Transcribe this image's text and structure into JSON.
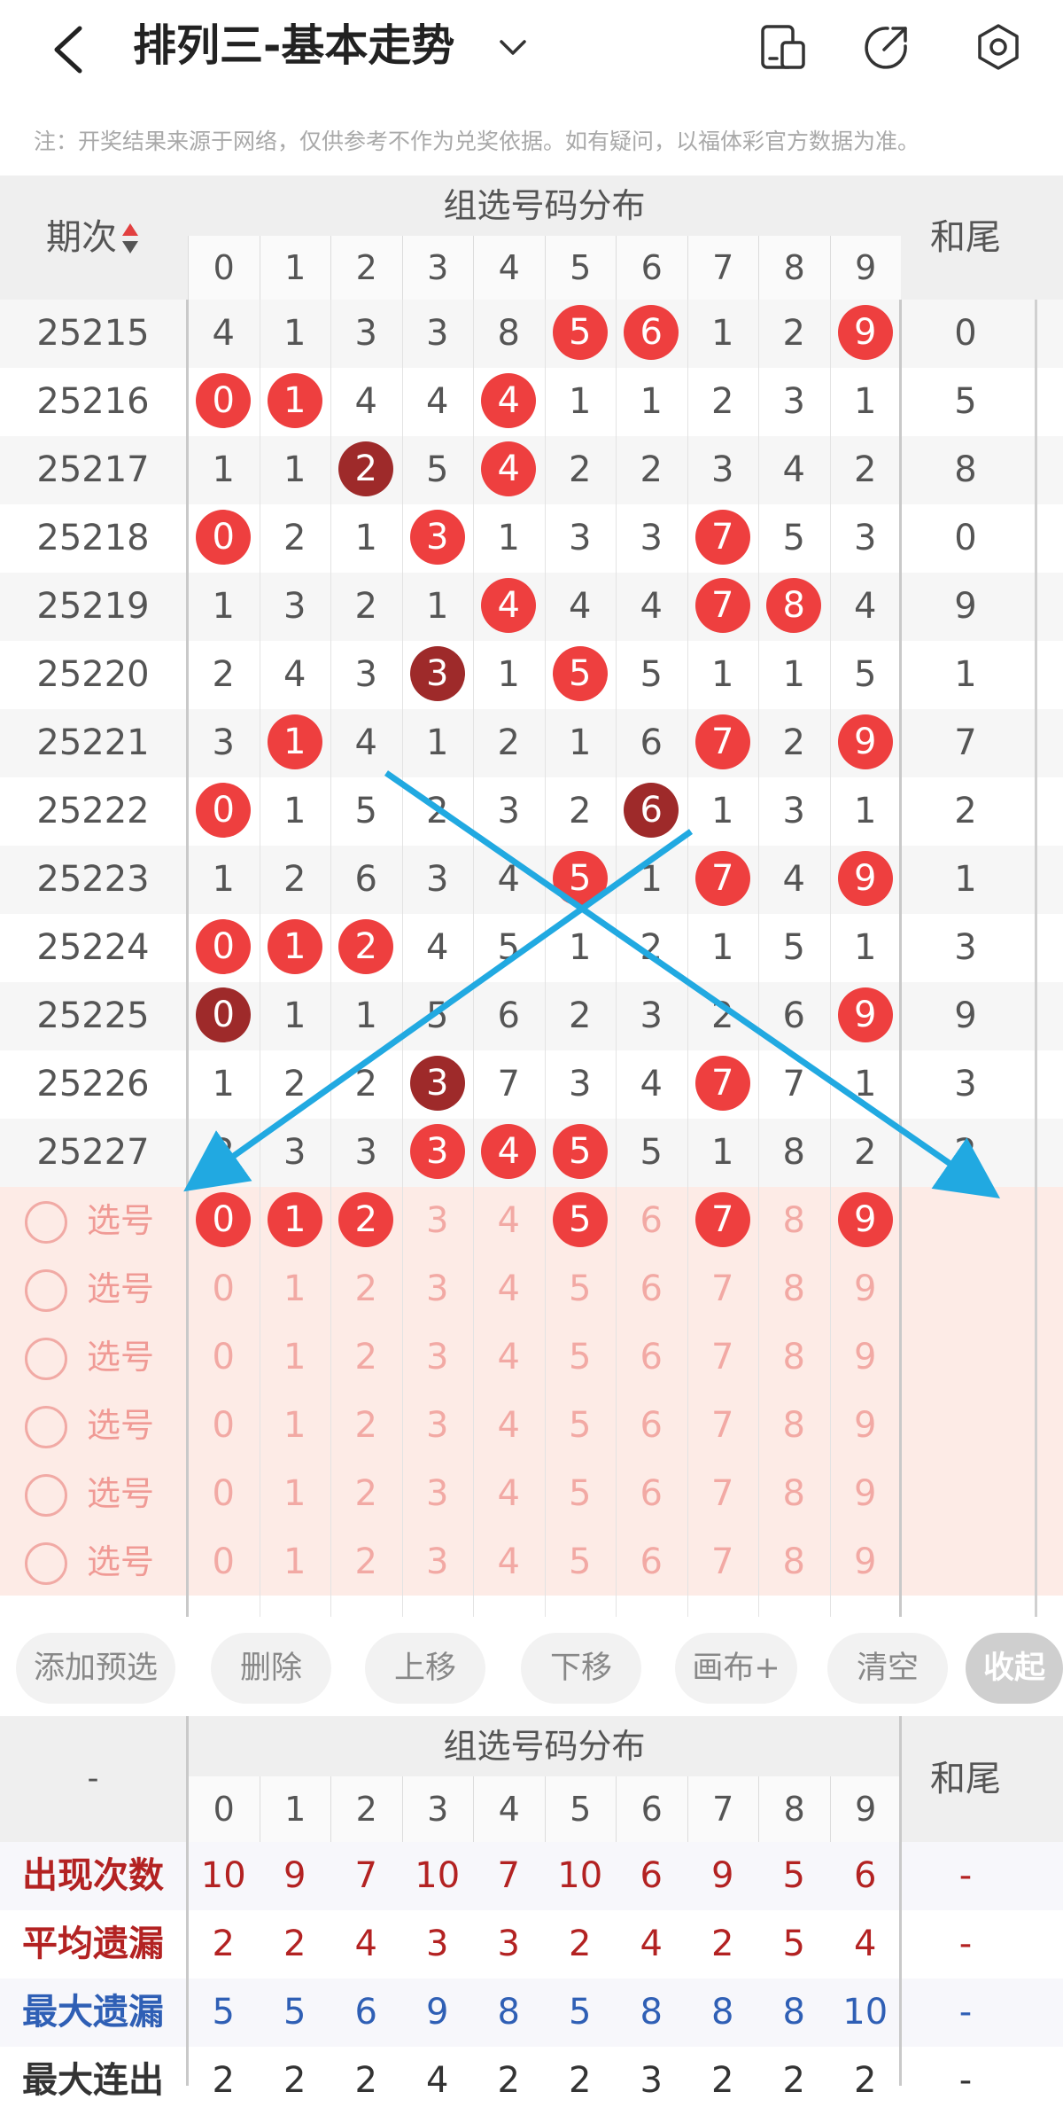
{
  "header": {
    "title": "排列三-基本走势",
    "back_icon": "back-chevron-icon",
    "dropdown_icon": "chevron-down-icon",
    "icons": [
      "device-switch-icon",
      "share-icon",
      "settings-icon"
    ]
  },
  "note": "注：开奖结果来源于网络，仅供参考不作为兑奖依据。如有疑问，以福体彩官方数据为准。",
  "table": {
    "period_header": "期次",
    "sort_icon": "sort-updown-icon",
    "group_header": "组选号码分布",
    "digits": [
      "0",
      "1",
      "2",
      "3",
      "4",
      "5",
      "6",
      "7",
      "8",
      "9"
    ],
    "tail_header": "和尾",
    "rows": [
      {
        "period": "25215",
        "cells": [
          "4",
          "1",
          "3",
          "3",
          "8",
          "5",
          "6",
          "1",
          "2",
          "9"
        ],
        "hl": [
          0,
          0,
          0,
          0,
          0,
          1,
          1,
          0,
          0,
          1
        ],
        "tail": "0"
      },
      {
        "period": "25216",
        "cells": [
          "0",
          "1",
          "4",
          "4",
          "4",
          "1",
          "1",
          "2",
          "3",
          "1"
        ],
        "hl": [
          1,
          1,
          0,
          0,
          1,
          0,
          0,
          0,
          0,
          0
        ],
        "tail": "5"
      },
      {
        "period": "25217",
        "cells": [
          "1",
          "1",
          "2",
          "5",
          "4",
          "2",
          "2",
          "3",
          "4",
          "2"
        ],
        "hl": [
          0,
          0,
          2,
          0,
          1,
          0,
          0,
          0,
          0,
          0
        ],
        "tail": "8"
      },
      {
        "period": "25218",
        "cells": [
          "0",
          "2",
          "1",
          "3",
          "1",
          "3",
          "3",
          "7",
          "5",
          "3"
        ],
        "hl": [
          1,
          0,
          0,
          1,
          0,
          0,
          0,
          1,
          0,
          0
        ],
        "tail": "0"
      },
      {
        "period": "25219",
        "cells": [
          "1",
          "3",
          "2",
          "1",
          "4",
          "4",
          "4",
          "7",
          "8",
          "4"
        ],
        "hl": [
          0,
          0,
          0,
          0,
          1,
          0,
          0,
          1,
          1,
          0
        ],
        "tail": "9"
      },
      {
        "period": "25220",
        "cells": [
          "2",
          "4",
          "3",
          "3",
          "1",
          "5",
          "5",
          "1",
          "1",
          "5"
        ],
        "hl": [
          0,
          0,
          0,
          2,
          0,
          1,
          0,
          0,
          0,
          0
        ],
        "tail": "1"
      },
      {
        "period": "25221",
        "cells": [
          "3",
          "1",
          "4",
          "1",
          "2",
          "1",
          "6",
          "7",
          "2",
          "9"
        ],
        "hl": [
          0,
          1,
          0,
          0,
          0,
          0,
          0,
          1,
          0,
          1
        ],
        "tail": "7"
      },
      {
        "period": "25222",
        "cells": [
          "0",
          "1",
          "5",
          "2",
          "3",
          "2",
          "6",
          "1",
          "3",
          "1"
        ],
        "hl": [
          1,
          0,
          0,
          0,
          0,
          0,
          2,
          0,
          0,
          0
        ],
        "tail": "2"
      },
      {
        "period": "25223",
        "cells": [
          "1",
          "2",
          "6",
          "3",
          "4",
          "5",
          "1",
          "7",
          "4",
          "9"
        ],
        "hl": [
          0,
          0,
          0,
          0,
          0,
          1,
          0,
          1,
          0,
          1
        ],
        "tail": "1"
      },
      {
        "period": "25224",
        "cells": [
          "0",
          "1",
          "2",
          "4",
          "5",
          "1",
          "2",
          "1",
          "5",
          "1"
        ],
        "hl": [
          1,
          1,
          1,
          0,
          0,
          0,
          0,
          0,
          0,
          0
        ],
        "tail": "3"
      },
      {
        "period": "25225",
        "cells": [
          "0",
          "1",
          "1",
          "5",
          "6",
          "2",
          "3",
          "2",
          "6",
          "9"
        ],
        "hl": [
          2,
          0,
          0,
          0,
          0,
          0,
          0,
          0,
          0,
          1
        ],
        "tail": "9"
      },
      {
        "period": "25226",
        "cells": [
          "1",
          "2",
          "2",
          "3",
          "7",
          "3",
          "4",
          "7",
          "7",
          "1"
        ],
        "hl": [
          0,
          0,
          0,
          2,
          0,
          0,
          0,
          1,
          0,
          0
        ],
        "tail": "3"
      },
      {
        "period": "25227",
        "cells": [
          "2",
          "3",
          "3",
          "3",
          "4",
          "5",
          "5",
          "1",
          "8",
          "2"
        ],
        "hl": [
          0,
          0,
          0,
          1,
          1,
          1,
          0,
          0,
          0,
          0
        ],
        "tail": "2"
      }
    ]
  },
  "picks": {
    "label": "选号",
    "radio_icon": "radio-circle-icon",
    "rows": [
      {
        "hl": [
          1,
          1,
          1,
          0,
          0,
          1,
          0,
          1,
          0,
          1
        ]
      },
      {
        "hl": [
          0,
          0,
          0,
          0,
          0,
          0,
          0,
          0,
          0,
          0
        ]
      },
      {
        "hl": [
          0,
          0,
          0,
          0,
          0,
          0,
          0,
          0,
          0,
          0
        ]
      },
      {
        "hl": [
          0,
          0,
          0,
          0,
          0,
          0,
          0,
          0,
          0,
          0
        ]
      },
      {
        "hl": [
          0,
          0,
          0,
          0,
          0,
          0,
          0,
          0,
          0,
          0
        ]
      },
      {
        "hl": [
          0,
          0,
          0,
          0,
          0,
          0,
          0,
          0,
          0,
          0
        ]
      }
    ]
  },
  "actions": [
    "添加预选",
    "删除",
    "上移",
    "下移",
    "画布+",
    "清空",
    "收起"
  ],
  "stats": {
    "dash": "-",
    "group_header": "组选号码分布",
    "tail_header": "和尾",
    "rows": [
      {
        "label": "出现次数",
        "color": "#b32222",
        "values": [
          "10",
          "9",
          "7",
          "10",
          "7",
          "10",
          "6",
          "9",
          "5",
          "6"
        ],
        "tail": "-"
      },
      {
        "label": "平均遗漏",
        "color": "#b32222",
        "values": [
          "2",
          "2",
          "4",
          "3",
          "3",
          "2",
          "4",
          "2",
          "5",
          "4"
        ],
        "tail": "-"
      },
      {
        "label": "最大遗漏",
        "color": "#2f5fb5",
        "values": [
          "5",
          "5",
          "6",
          "9",
          "8",
          "5",
          "8",
          "8",
          "8",
          "10"
        ],
        "tail": "-"
      },
      {
        "label": "最大连出",
        "color": "#333333",
        "values": [
          "2",
          "2",
          "2",
          "4",
          "2",
          "2",
          "3",
          "2",
          "2",
          "2"
        ],
        "tail": "-"
      }
    ]
  },
  "colors": {
    "ball_red": "#ee3f3f",
    "ball_dark": "#9e2a2a",
    "pick_bg": "#fdebe6",
    "arrow": "#21a9e1"
  }
}
